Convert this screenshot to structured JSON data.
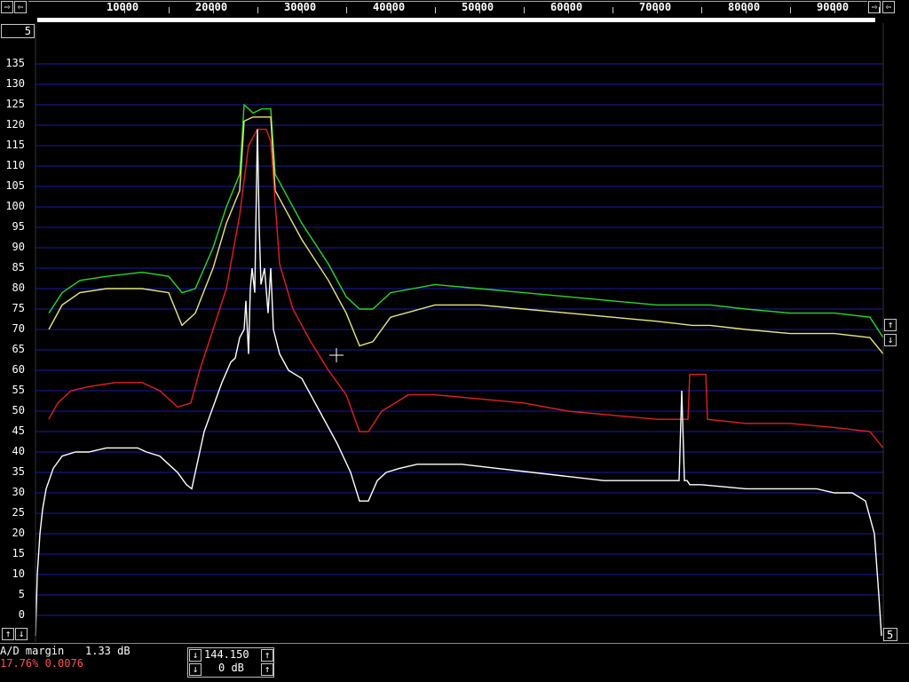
{
  "top_scale": {
    "ticks": [
      "10000",
      "20000",
      "30000",
      "40000",
      "50000",
      "60000",
      "70000",
      "80000",
      "90000"
    ],
    "left_arrow": "⇨",
    "left_arrow2": "⇦",
    "right_arrow": "⇨",
    "right_arrow2": "⇦"
  },
  "corner_labels": {
    "top_left_value": "5",
    "bottom_right_value": "5"
  },
  "y_axis": {
    "ticks": [
      "135",
      "130",
      "125",
      "120",
      "115",
      "110",
      "105",
      "100",
      "95",
      "90",
      "85",
      "80",
      "75",
      "70",
      "65",
      "60",
      "55",
      "50",
      "45",
      "40",
      "35",
      "30",
      "25",
      "20",
      "15",
      "10",
      "5",
      "0"
    ]
  },
  "status": {
    "ad_margin_label": "A/D margin",
    "ad_margin_value": "1.33 dB",
    "percent_text": "17.76% 0.0076"
  },
  "controls": {
    "frequency_value": "144.150",
    "gain_value": "0 dB"
  },
  "colors": {
    "grid": "#1a1aa8",
    "green": "#27d827",
    "yellow": "#e8e87a",
    "red": "#e02020",
    "white": "#ffffff",
    "alert_text": "#ff5050"
  },
  "chart_data": {
    "type": "line",
    "xlim": [
      0,
      95000
    ],
    "ylim": [
      -5,
      140
    ],
    "series": [
      {
        "color": "green",
        "x": [
          1500,
          3000,
          5000,
          8000,
          12000,
          15000,
          16500,
          18000,
          20000,
          21500,
          23000,
          23500,
          24500,
          25500,
          26500,
          27000,
          28500,
          30000,
          33000,
          35000,
          36500,
          38000,
          40000,
          45000,
          50000,
          55000,
          60000,
          70000,
          74000,
          76000,
          80000,
          85000,
          90000,
          94000,
          95500
        ],
        "y": [
          74,
          79,
          82,
          83,
          84,
          83,
          79,
          80,
          90,
          100,
          108,
          125,
          123,
          124,
          124,
          108,
          102,
          96,
          86,
          78,
          75,
          75,
          79,
          81,
          80,
          79,
          78,
          76,
          76,
          76,
          75,
          74,
          74,
          73,
          68
        ]
      },
      {
        "color": "yellow",
        "x": [
          1500,
          3000,
          5000,
          8000,
          12000,
          15000,
          16500,
          18000,
          20000,
          21500,
          23000,
          23500,
          24500,
          25500,
          26500,
          27000,
          28500,
          30000,
          33000,
          35000,
          36500,
          38000,
          40000,
          45000,
          50000,
          55000,
          60000,
          70000,
          74000,
          76000,
          80000,
          85000,
          90000,
          94000,
          95500
        ],
        "y": [
          70,
          76,
          79,
          80,
          80,
          79,
          71,
          74,
          85,
          96,
          104,
          121,
          122,
          122,
          122,
          104,
          98,
          92,
          82,
          74,
          66,
          67,
          73,
          76,
          76,
          75,
          74,
          72,
          71,
          71,
          70,
          69,
          69,
          68,
          64
        ]
      },
      {
        "color": "red",
        "x": [
          1500,
          2500,
          4000,
          6000,
          9000,
          12000,
          14000,
          16000,
          17500,
          18500,
          20000,
          21500,
          23000,
          24000,
          25000,
          26000,
          26500,
          27500,
          29000,
          31000,
          33000,
          35000,
          36500,
          37500,
          39000,
          42000,
          45000,
          50000,
          55000,
          60000,
          65000,
          70000,
          73500,
          73700,
          75500,
          75700,
          80000,
          85000,
          90000,
          94000,
          95500
        ],
        "y": [
          48,
          52,
          55,
          56,
          57,
          57,
          55,
          51,
          52,
          60,
          70,
          80,
          98,
          115,
          119,
          119,
          116,
          86,
          75,
          67,
          60,
          54,
          45,
          45,
          50,
          54,
          54,
          53,
          52,
          50,
          49,
          48,
          48,
          59,
          59,
          48,
          47,
          47,
          46,
          45,
          41
        ]
      },
      {
        "color": "white",
        "x": [
          0,
          200,
          500,
          800,
          1200,
          2000,
          3000,
          4500,
          6000,
          8000,
          10000,
          11500,
          12500,
          14000,
          15000,
          16000,
          17000,
          17600,
          18300,
          19000,
          20000,
          21000,
          22000,
          22500,
          23000,
          23500,
          23700,
          24000,
          24200,
          24400,
          24700,
          25000,
          25200,
          25400,
          25800,
          26200,
          26500,
          26800,
          27500,
          28500,
          30000,
          32000,
          34000,
          35500,
          36500,
          37500,
          38500,
          39500,
          41000,
          43000,
          45000,
          48000,
          52000,
          56000,
          60000,
          64000,
          68000,
          71000,
          72500,
          72800,
          73100,
          73400,
          73700,
          75000,
          80000,
          85000,
          88000,
          90000,
          92000,
          93500,
          94500,
          95000,
          95300
        ],
        "y": [
          -5,
          10,
          20,
          26,
          31,
          36,
          39,
          40,
          40,
          41,
          41,
          41,
          40,
          39,
          37,
          35,
          32,
          31,
          38,
          45,
          51,
          57,
          62,
          63,
          68,
          70,
          77,
          64,
          80,
          85,
          79,
          119,
          95,
          81,
          85,
          74,
          85,
          70,
          64,
          60,
          58,
          50,
          42,
          35,
          28,
          28,
          33,
          35,
          36,
          37,
          37,
          37,
          36,
          35,
          34,
          33,
          33,
          33,
          33,
          55,
          33,
          33,
          32,
          32,
          31,
          31,
          31,
          30,
          30,
          28,
          20,
          5,
          -5
        ]
      }
    ]
  }
}
